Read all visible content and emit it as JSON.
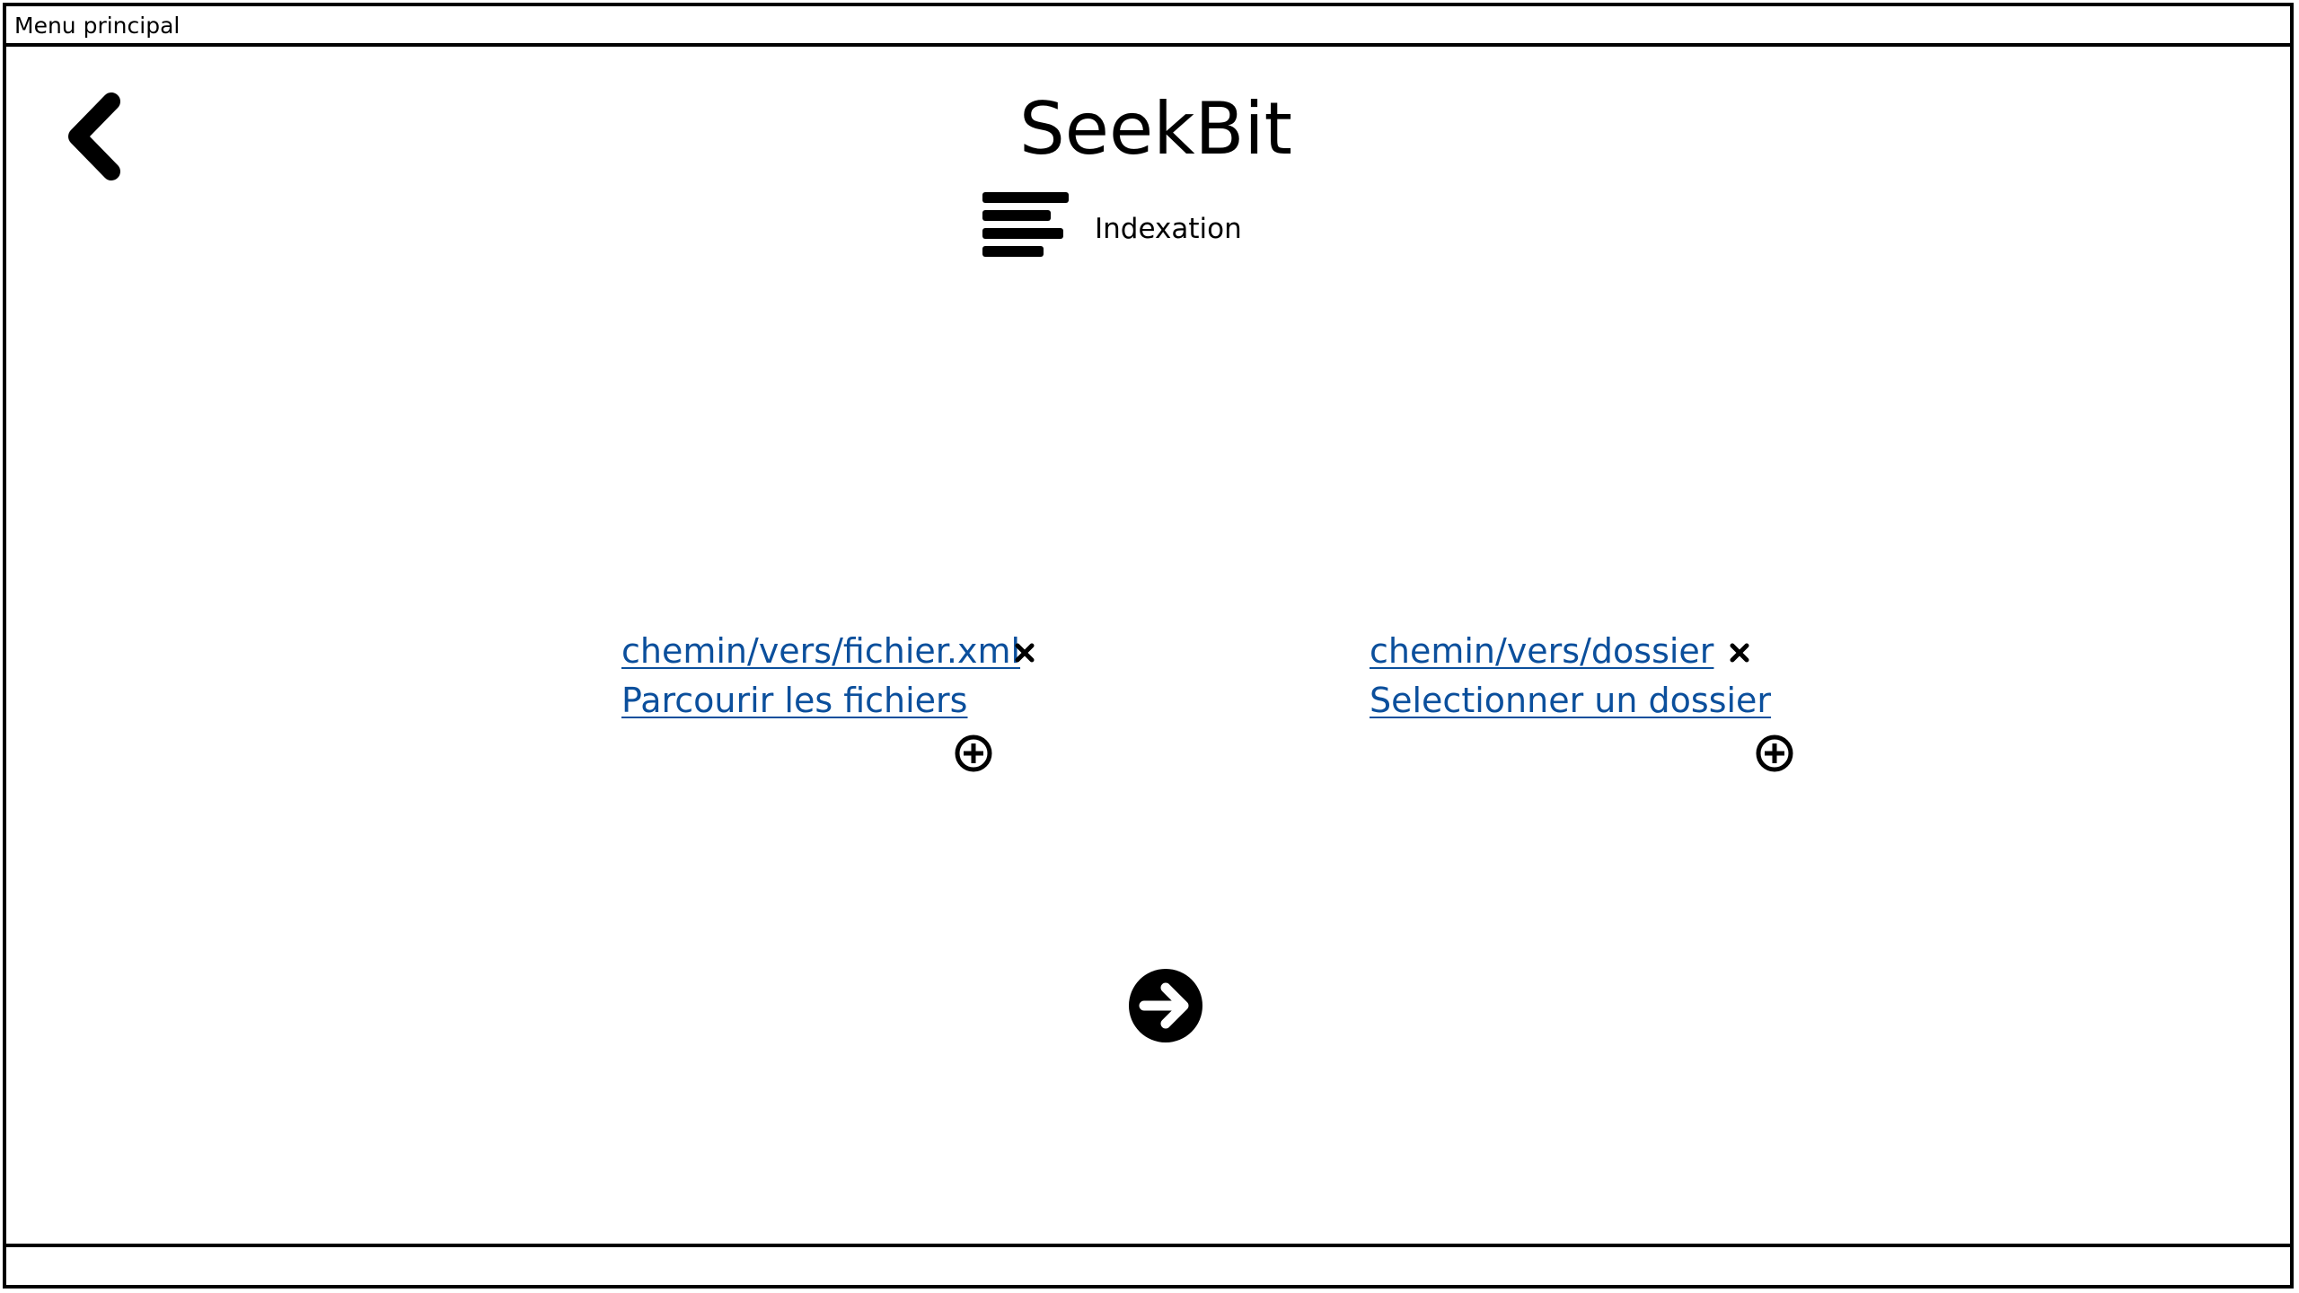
{
  "window": {
    "title": "Menu principal"
  },
  "header": {
    "app_title": "SeekBit",
    "back_icon": "chevron-left-icon",
    "section_icon": "align-left-icon",
    "section_label": "Indexation"
  },
  "files": {
    "path": "chemin/vers/fichier.xml",
    "browse_label": "Parcourir les fichiers",
    "remove_icon": "close-icon",
    "add_icon": "plus-circle-icon"
  },
  "folders": {
    "path": "chemin/vers/dossier",
    "browse_label": "Selectionner un dossier",
    "remove_icon": "close-icon",
    "add_icon": "plus-circle-icon"
  },
  "actions": {
    "next_icon": "arrow-right-circle-icon"
  },
  "colors": {
    "link": "#0b4f9c",
    "border": "#000000",
    "background": "#ffffff"
  }
}
